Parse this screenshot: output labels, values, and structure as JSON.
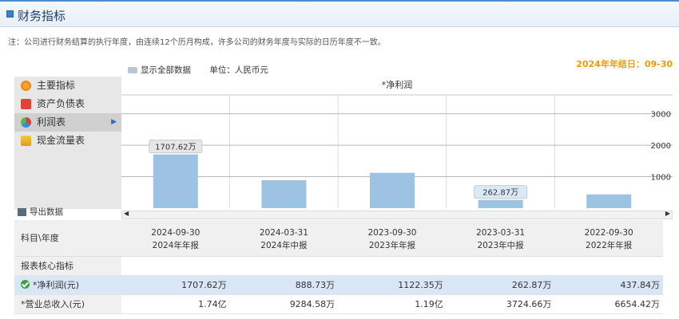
{
  "header": {
    "title": "财务指标"
  },
  "note": "注：公司进行财务结算的执行年度，由连续12个历月构成，许多公司的财务年度与实际的日历年度不一致。",
  "fiscal_year_end": "2024年年结日：09-30",
  "toolbar": {
    "show_all_label": "显示全部数据",
    "unit_label": "单位：人民币元"
  },
  "nav": [
    {
      "label": "主要指标",
      "icon": "main-indicator-icon"
    },
    {
      "label": "资产负债表",
      "icon": "balance-sheet-icon"
    },
    {
      "label": "利润表",
      "icon": "income-statement-icon",
      "active": true
    },
    {
      "label": "现金流量表",
      "icon": "cash-flow-icon"
    }
  ],
  "export_label": "导出数据",
  "chart_data": {
    "type": "bar",
    "title": "*净利润",
    "categories": [
      "2024-09-30",
      "2024-03-31",
      "2023-09-30",
      "2023-03-31",
      "2022-09-30"
    ],
    "values": [
      1707.62,
      888.73,
      1122.35,
      262.87,
      437.84
    ],
    "yticks": [
      "1000",
      "2000",
      "3000"
    ],
    "ylim": [
      0,
      3600
    ],
    "data_labels": [
      {
        "index": 0,
        "text": "1707.62万"
      },
      {
        "index": 3,
        "text": "262.87万"
      }
    ],
    "color": "#9ec3e2",
    "grid": true
  },
  "table": {
    "header_label": "科目\\年度",
    "columns": [
      {
        "date": "2024-09-30",
        "type": "2024年年报"
      },
      {
        "date": "2024-03-31",
        "type": "2024年中报"
      },
      {
        "date": "2023-09-30",
        "type": "2023年年报"
      },
      {
        "date": "2023-03-31",
        "type": "2023年中报"
      },
      {
        "date": "2022-09-30",
        "type": "2022年年报"
      }
    ],
    "section_label": "报表核心指标",
    "rows": [
      {
        "label": "*净利润(元)",
        "values": [
          "1707.62万",
          "888.73万",
          "1122.35万",
          "262.87万",
          "437.84万"
        ]
      },
      {
        "label": "*营业总收入(元)",
        "values": [
          "1.74亿",
          "9284.58万",
          "1.19亿",
          "3724.66万",
          "6654.42万"
        ]
      }
    ]
  }
}
